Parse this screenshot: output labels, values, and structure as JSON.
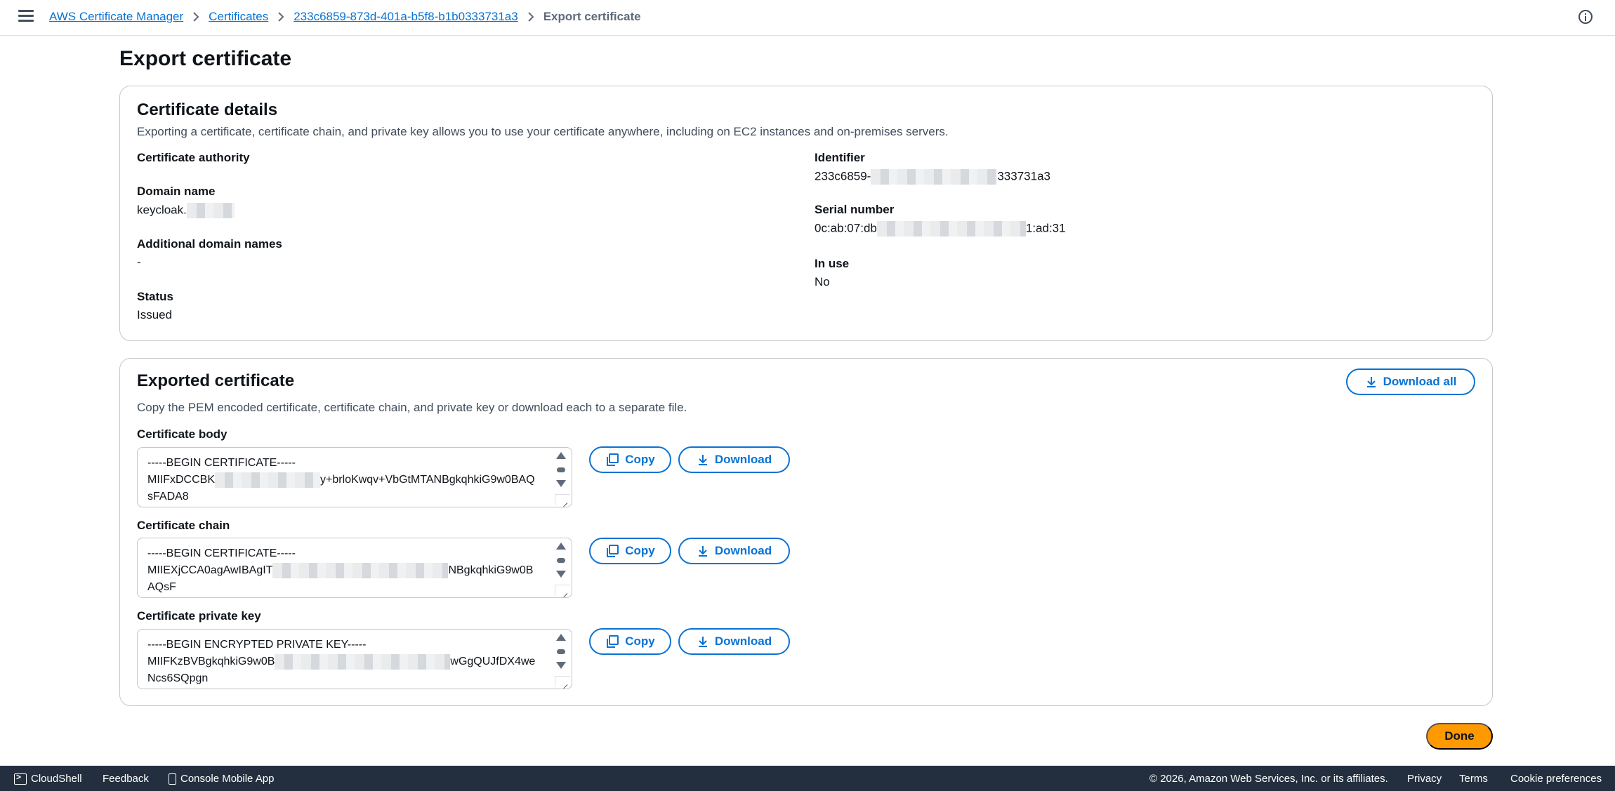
{
  "breadcrumb": {
    "items": [
      "AWS Certificate Manager",
      "Certificates",
      "233c6859-873d-401a-b5f8-b1b0333731a3"
    ],
    "current": "Export certificate"
  },
  "page": {
    "title": "Export certificate"
  },
  "details": {
    "title": "Certificate details",
    "description": "Exporting a certificate, certificate chain, and private key allows you to use your certificate anywhere, including on EC2 instances and on-premises servers.",
    "left": [
      {
        "label": "Certificate authority",
        "value": ""
      },
      {
        "label": "Domain name",
        "value": "keycloak."
      },
      {
        "label": "Additional domain names",
        "value": "-"
      },
      {
        "label": "Status",
        "value": "Issued"
      }
    ],
    "identifier": {
      "label": "Identifier",
      "value_start": "233c6859-",
      "value_end": "333731a3"
    },
    "serial": {
      "label": "Serial number",
      "value_start": "0c:ab:07:db",
      "value_end": "1:ad:31"
    },
    "in_use": {
      "label": "In use",
      "value": "No"
    }
  },
  "exported": {
    "title": "Exported certificate",
    "description": "Copy the PEM encoded certificate, certificate chain, and private key or download each to a separate file.",
    "download_all_label": "Download all",
    "copy_label": "Copy",
    "download_label": "Download",
    "fields": [
      {
        "label": "Certificate body",
        "line1": "-----BEGIN CERTIFICATE-----",
        "line2_start": "MIIFxDCCBK",
        "line2_end": "y+brloKwqv+VbGtMTANBgkqhkiG9w0BAQ",
        "line3": "sFADA8"
      },
      {
        "label": "Certificate chain",
        "line1": "-----BEGIN CERTIFICATE-----",
        "line2_start": "MIIEXjCCA0agAwIBAgIT",
        "line2_end": "NBgkqhkiG9w0B",
        "line3": "AQsF"
      },
      {
        "label": "Certificate private key",
        "line1": "-----BEGIN ENCRYPTED PRIVATE KEY-----",
        "line2_start": "MIIFKzBVBgkqhkiG9w0B",
        "line2_end": "wGgQUJfDX4we",
        "line3": "Ncs6SQpgn"
      }
    ]
  },
  "done_label": "Done",
  "footer": {
    "cloudshell": "CloudShell",
    "feedback": "Feedback",
    "mobile_app": "Console Mobile App",
    "copyright": "© 2026, Amazon Web Services, Inc. or its affiliates.",
    "privacy": "Privacy",
    "terms": "Terms",
    "cookies": "Cookie preferences"
  },
  "colors": {
    "link": "#0972d3",
    "primary": "#ff9900",
    "footer_bg": "#232f3e",
    "border": "#c6c6cd"
  }
}
